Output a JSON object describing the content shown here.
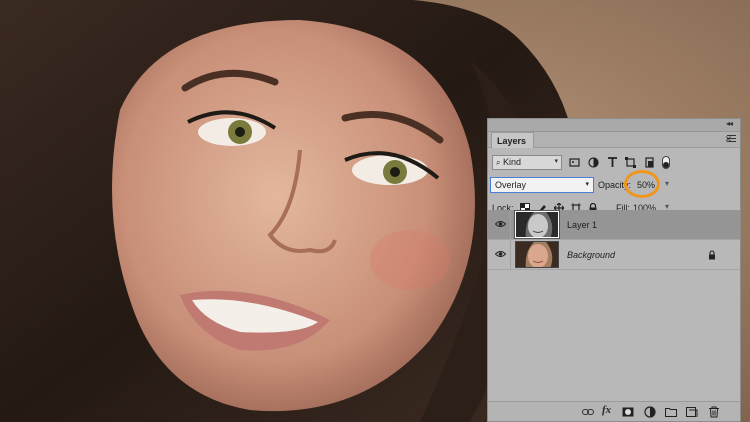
{
  "panel": {
    "collapse_icon": "double-chevron-icon",
    "tab_label": "Layers",
    "close_icon": "close-icon",
    "menu_icon": "hamburger-menu-icon"
  },
  "filter": {
    "kind_label": "Kind",
    "icons": [
      "pixel-filter-icon",
      "adjustment-filter-icon",
      "type-filter-icon",
      "shape-filter-icon",
      "smart-object-filter-icon",
      "filter-toggle-icon"
    ]
  },
  "blend": {
    "mode": "Overlay",
    "opacity_label": "Opacity:",
    "opacity_value": "50%",
    "highlight_color": "#f0961c"
  },
  "lock": {
    "label": "Lock:",
    "icons": [
      "lock-transparency-icon",
      "lock-pixels-icon",
      "lock-position-icon",
      "lock-artboard-icon",
      "lock-all-icon"
    ],
    "fill_label": "Fill:",
    "fill_value": "100%"
  },
  "layers": [
    {
      "name": "Layer 1",
      "selected": true,
      "visible": true
    },
    {
      "name": "Background",
      "selected": false,
      "visible": true,
      "locked": true
    }
  ],
  "footer": {
    "icons": [
      "link-layers-icon",
      "fx-icon",
      "mask-icon",
      "adjustment-layer-icon",
      "new-group-icon",
      "new-layer-icon",
      "trash-icon"
    ],
    "fx_label": "fx"
  },
  "colors": {
    "panel_bg": "#b8b8b8",
    "selected_layer": "#959595",
    "accent": "#4a7fd8"
  }
}
